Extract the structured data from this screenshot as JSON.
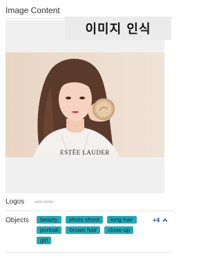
{
  "section": {
    "title": "Image Content"
  },
  "image": {
    "badge": "이미지 인식",
    "brand_text": "ESTĒE LAUDER"
  },
  "logos": {
    "label": "Logos",
    "value": "estée lauder"
  },
  "objects": {
    "label": "Objects",
    "tags": [
      "beauty",
      "photo shoot",
      "long hair",
      "portrait",
      "brown hair",
      "close-up",
      "girl"
    ],
    "more": "+4"
  },
  "colors": {
    "tag_bg": "#23a9b6",
    "more_link": "#1f4e8c"
  },
  "icons": {
    "collapse": "chevron-up-icon"
  }
}
